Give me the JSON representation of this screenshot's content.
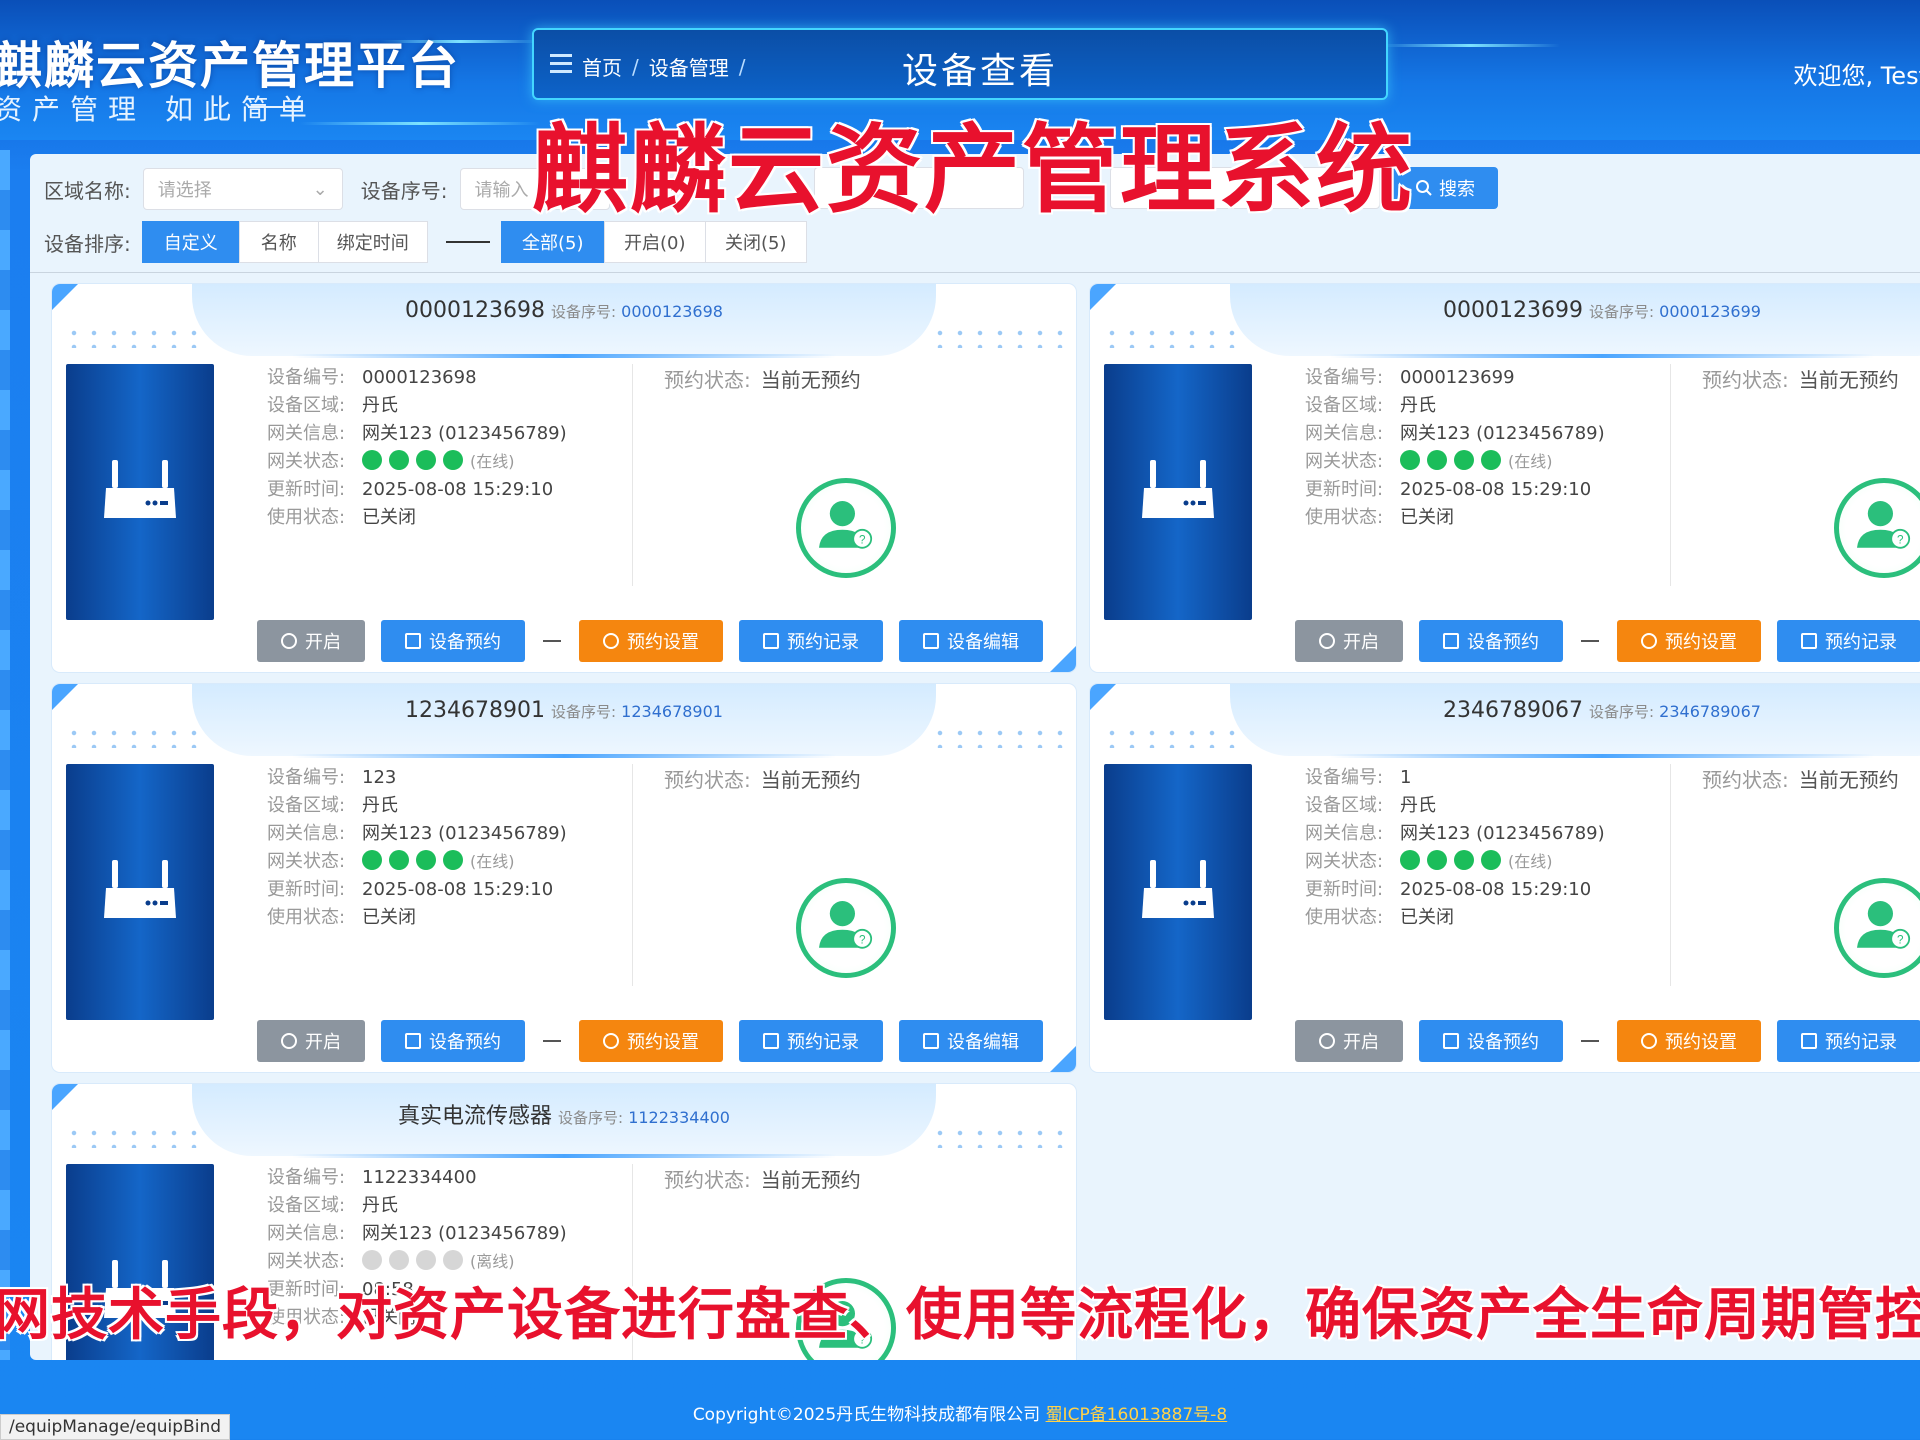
{
  "header": {
    "brand_title": "麒麟云资产管理平台",
    "brand_subtitle": "资产管理 如此简单",
    "breadcrumb": [
      "首页",
      "设备管理"
    ],
    "page_title": "设备查看",
    "welcome": "欢迎您, Test",
    "overlay_title": "麒麟云资产管理系统"
  },
  "filters": {
    "area_label": "区域名称:",
    "area_placeholder": "请选择",
    "seq_label": "设备序号:",
    "seq_placeholder": "请输入",
    "search_label": "搜索",
    "sort_label": "设备排序:",
    "sort_options": [
      "自定义",
      "名称",
      "绑定时间"
    ],
    "sort_active": "自定义",
    "status_options": [
      "全部(5)",
      "开启(0)",
      "关闭(5)"
    ],
    "status_active": "全部(5)"
  },
  "labels": {
    "seq": "设备序号:",
    "code": "设备编号:",
    "area": "设备区域:",
    "gateway": "网关信息:",
    "gateway_status": "网关状态:",
    "updated": "更新时间:",
    "usage": "使用状态:",
    "reservation": "预约状态:",
    "online": "(在线)",
    "offline": "(离线)"
  },
  "buttons": {
    "open": "开启",
    "reserve": "设备预约",
    "reserve_settings": "预约设置",
    "reserve_records": "预约记录",
    "edit": "设备编辑"
  },
  "devices": [
    {
      "name": "0000123698",
      "seq": "0000123698",
      "code": "0000123698",
      "area": "丹氏",
      "gateway": "网关123 (0123456789)",
      "online": true,
      "updated": "2025-08-08 15:29:10",
      "usage": "已关闭",
      "reservation": "当前无预约"
    },
    {
      "name": "0000123699",
      "seq": "0000123699",
      "code": "0000123699",
      "area": "丹氏",
      "gateway": "网关123 (0123456789)",
      "online": true,
      "updated": "2025-08-08 15:29:10",
      "usage": "已关闭",
      "reservation": "当前无预约"
    },
    {
      "name": "1234678901",
      "seq": "1234678901",
      "code": "123",
      "area": "丹氏",
      "gateway": "网关123 (0123456789)",
      "online": true,
      "updated": "2025-08-08 15:29:10",
      "usage": "已关闭",
      "reservation": "当前无预约"
    },
    {
      "name": "2346789067",
      "seq": "2346789067",
      "code": "1",
      "area": "丹氏",
      "gateway": "网关123 (0123456789)",
      "online": true,
      "updated": "2025-08-08 15:29:10",
      "usage": "已关闭",
      "reservation": "当前无预约"
    },
    {
      "name": "真实电流传感器",
      "seq": "1122334400",
      "code": "1122334400",
      "area": "丹氏",
      "gateway": "网关123 (0123456789)",
      "online": false,
      "updated": "08:58",
      "usage": "已关闭",
      "reservation": "当前无预约"
    }
  ],
  "bottom_subtitle": "网技术手段，对资产设备进行盘查、使用等流程化，确保资产全生命周期管控",
  "footer": {
    "copyright": "Copyright©2025丹氏生物科技成都有限公司",
    "icp": "蜀ICP备16013887号-8"
  },
  "status_url": "/equipManage/equipBind",
  "colors": {
    "primary": "#2f8df0",
    "orange": "#f5860f",
    "online": "#1bbd5a",
    "overlay_red": "#e8112d"
  }
}
